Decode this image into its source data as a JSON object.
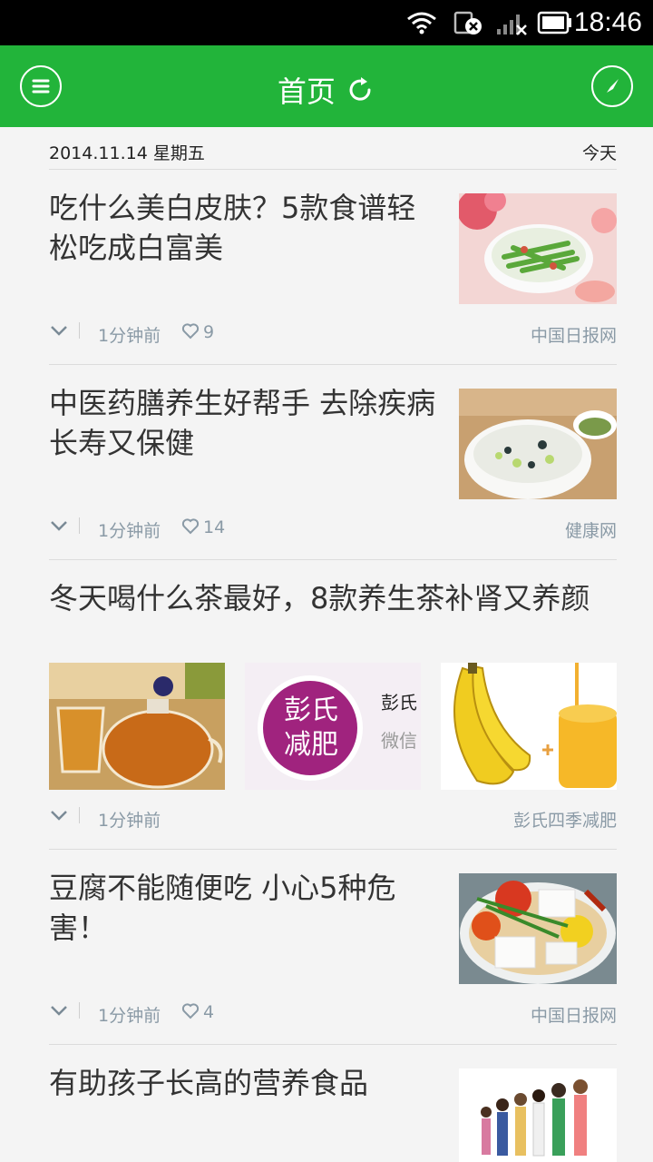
{
  "status_bar": {
    "time": "18:46",
    "icons": [
      "wifi-icon",
      "sim-card-off-icon",
      "signal-icon",
      "battery-icon"
    ]
  },
  "app_bar": {
    "title": "首页",
    "menu_icon": "menu-icon",
    "refresh_icon": "refresh-icon",
    "compass_icon": "compass-icon",
    "color": "#22b43a"
  },
  "dateline": {
    "date": "2014.11.14 星期五",
    "today": "今天"
  },
  "articles": [
    {
      "title": "吃什么美白皮肤？5款食谱轻松吃成白富美",
      "time": "1分钟前",
      "likes": "9",
      "source": "中国日报网",
      "image": "green-beans-bowl-photo"
    },
    {
      "title": "中医药膳养生好帮手 去除疾病长寿又保健",
      "time": "1分钟前",
      "likes": "14",
      "source": "健康网",
      "image": "porridge-bowl-photo"
    },
    {
      "title": "冬天喝什么茶最好，8款养生茶补肾又养颜",
      "time": "1分钟前",
      "source": "彭氏四季减肥",
      "images": {
        "tea": "tea-pot-photo",
        "bananas": "banana-honey-photo"
      },
      "logo": {
        "text_line1": "彭氏",
        "text_line2": "减肥",
        "side_title": "彭氏",
        "side_sub": "微信"
      }
    },
    {
      "title": "豆腐不能随便吃 小心5种危害！",
      "time": "1分钟前",
      "likes": "4",
      "source": "中国日报网",
      "image": "tofu-soup-photo"
    },
    {
      "title": "有助孩子长高的营养食品",
      "image": "children-photo"
    }
  ]
}
